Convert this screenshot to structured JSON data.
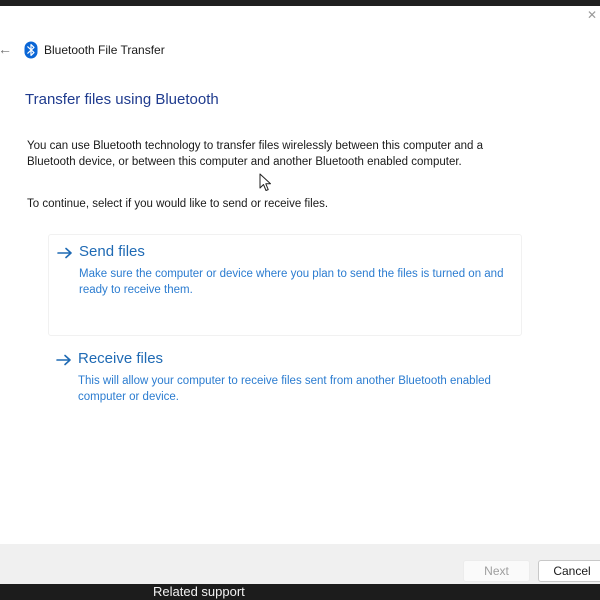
{
  "window": {
    "title": "Bluetooth File Transfer",
    "close_glyph": "✕",
    "back_glyph": "←"
  },
  "content": {
    "heading": "Transfer files using Bluetooth",
    "description": "You can use Bluetooth technology to transfer files wirelessly between this computer and a Bluetooth device, or between this computer and another Bluetooth enabled computer.",
    "instruction": "To continue, select if you would like to send or receive files."
  },
  "options": {
    "send": {
      "title": "Send files",
      "description": "Make sure the computer or device where you plan to send the files is turned on and ready to receive them."
    },
    "receive": {
      "title": "Receive files",
      "description": "This will allow your computer to receive files sent from another Bluetooth enabled computer or device."
    }
  },
  "footer": {
    "next_label": "Next",
    "next_enabled": false,
    "cancel_label": "Cancel"
  },
  "taskbar": {
    "text": "Related support"
  },
  "colors": {
    "heading": "#1f3b8e",
    "link": "#1f6ab4",
    "bluetooth_brand": "#0a66d6"
  },
  "icons": {
    "title_icon": "bluetooth-icon",
    "option_icon": "arrow-right-icon",
    "pointer": "mouse-cursor-icon"
  }
}
